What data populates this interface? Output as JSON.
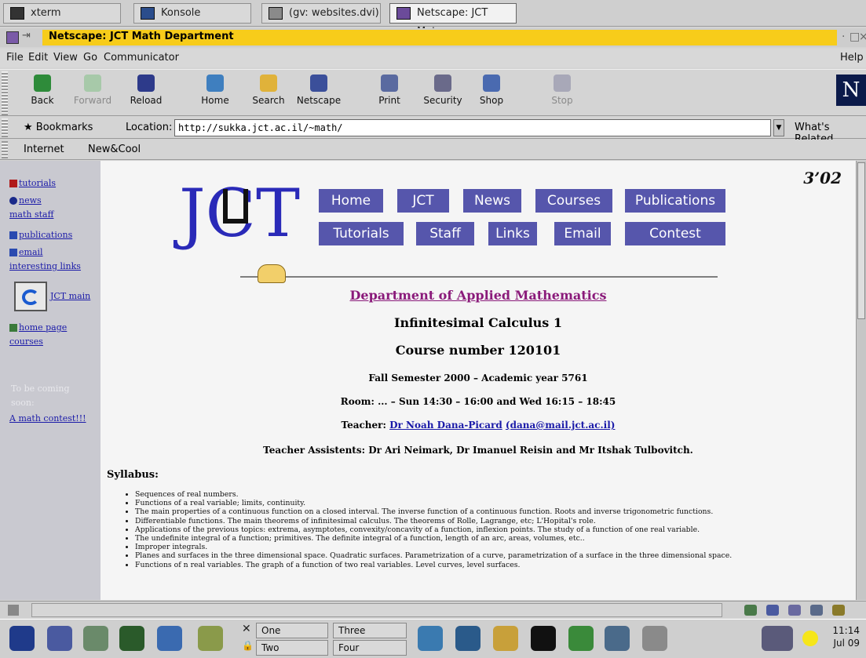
{
  "taskbar": {
    "tasks": [
      {
        "label": "xterm"
      },
      {
        "label": "Konsole"
      },
      {
        "label": "(gv: websites.dvi)"
      },
      {
        "label": "Netscape: JCT Mat..."
      }
    ]
  },
  "window": {
    "title": "Netscape: JCT Math Department",
    "title_color": "#f7cc1a"
  },
  "menu": {
    "items": [
      "File",
      "Edit",
      "View",
      "Go",
      "Communicator"
    ],
    "help": "Help"
  },
  "toolbar": {
    "buttons": [
      {
        "label": "Back",
        "icon": "back-arrow-icon"
      },
      {
        "label": "Forward",
        "icon": "forward-arrow-icon"
      },
      {
        "label": "Reload",
        "icon": "reload-icon"
      },
      {
        "label": "Home",
        "icon": "home-icon"
      },
      {
        "label": "Search",
        "icon": "search-icon"
      },
      {
        "label": "Netscape",
        "icon": "netscape-icon"
      },
      {
        "label": "Print",
        "icon": "printer-icon"
      },
      {
        "label": "Security",
        "icon": "lock-icon"
      },
      {
        "label": "Shop",
        "icon": "shop-icon"
      },
      {
        "label": "Stop",
        "icon": "stop-icon"
      }
    ],
    "logo": "N"
  },
  "location": {
    "bookmarks": "Bookmarks",
    "label": "Location:",
    "url": "http://sukka.jct.ac.il/~math/",
    "related": "What's Related"
  },
  "personal": {
    "internet": "Internet",
    "newcool": "New&Cool"
  },
  "sidebar": {
    "tutorials": "tutorials",
    "news": "news",
    "math_staff": "math staff",
    "publications": "publications",
    "email": "email",
    "interesting": "interesting links",
    "jct_main": "JCT main",
    "home_page": "home page",
    "courses": "courses",
    "coming": "To be coming soon:",
    "contest": "A math contest!!!"
  },
  "page": {
    "note": "3’02",
    "nav": [
      "Home",
      "JCT",
      "News",
      "Courses",
      "Publications",
      "Tutorials",
      "Staff",
      "Links",
      "Email",
      "Contest"
    ],
    "nav_color": "#5656ac",
    "department": "Department of Applied Mathematics",
    "course": "Infinitesimal Calculus 1",
    "course_number": "Course number 120101",
    "semester": "Fall Semester 2000 – Academic year 5761",
    "room": "Room: ... – Sun 14:30 – 16:00 and Wed 16:15 – 18:45",
    "teacher_label": "Teacher:",
    "teacher_name": "Dr Noah Dana-Picard",
    "teacher_email": "(dana@mail.jct.ac.il)",
    "assistants": "Teacher Assistents: Dr Ari Neimark, Dr Imanuel Reisin and Mr Itshak Tulbovitch.",
    "syllabus_title": "Syllabus:",
    "syllabus": [
      "Sequences of real numbers.",
      "Functions of a real variable; limits, continuity.",
      "The main properties of a continuous function on a closed interval. The inverse function of a continuous function. Roots and inverse trigonometric functions.",
      "Differentiable functions. The main theorems of infinitesimal calculus. The theorems of Rolle, Lagrange, etc; L'Hopital's role.",
      "Applications of the previous topics: extrema, asymptotes, convexity/concavity of a function, inflexion points. The study of a function of one real variable.",
      "The undefinite integral of a function; primitives. The definite integral of a function, length of an arc, areas, volumes, etc..",
      "Improper integrals.",
      "Planes and surfaces in the three dimensional space. Quadratic surfaces. Parametrization of a curve, parametrization of a surface in the three dimensional space.",
      "Functions of n real variables. The graph of a function of two real variables. Level curves, level surfaces."
    ]
  },
  "panel": {
    "desktops": [
      "One",
      "Three",
      "Two",
      "Four"
    ],
    "time": "11:14",
    "date": "Jul 09"
  }
}
